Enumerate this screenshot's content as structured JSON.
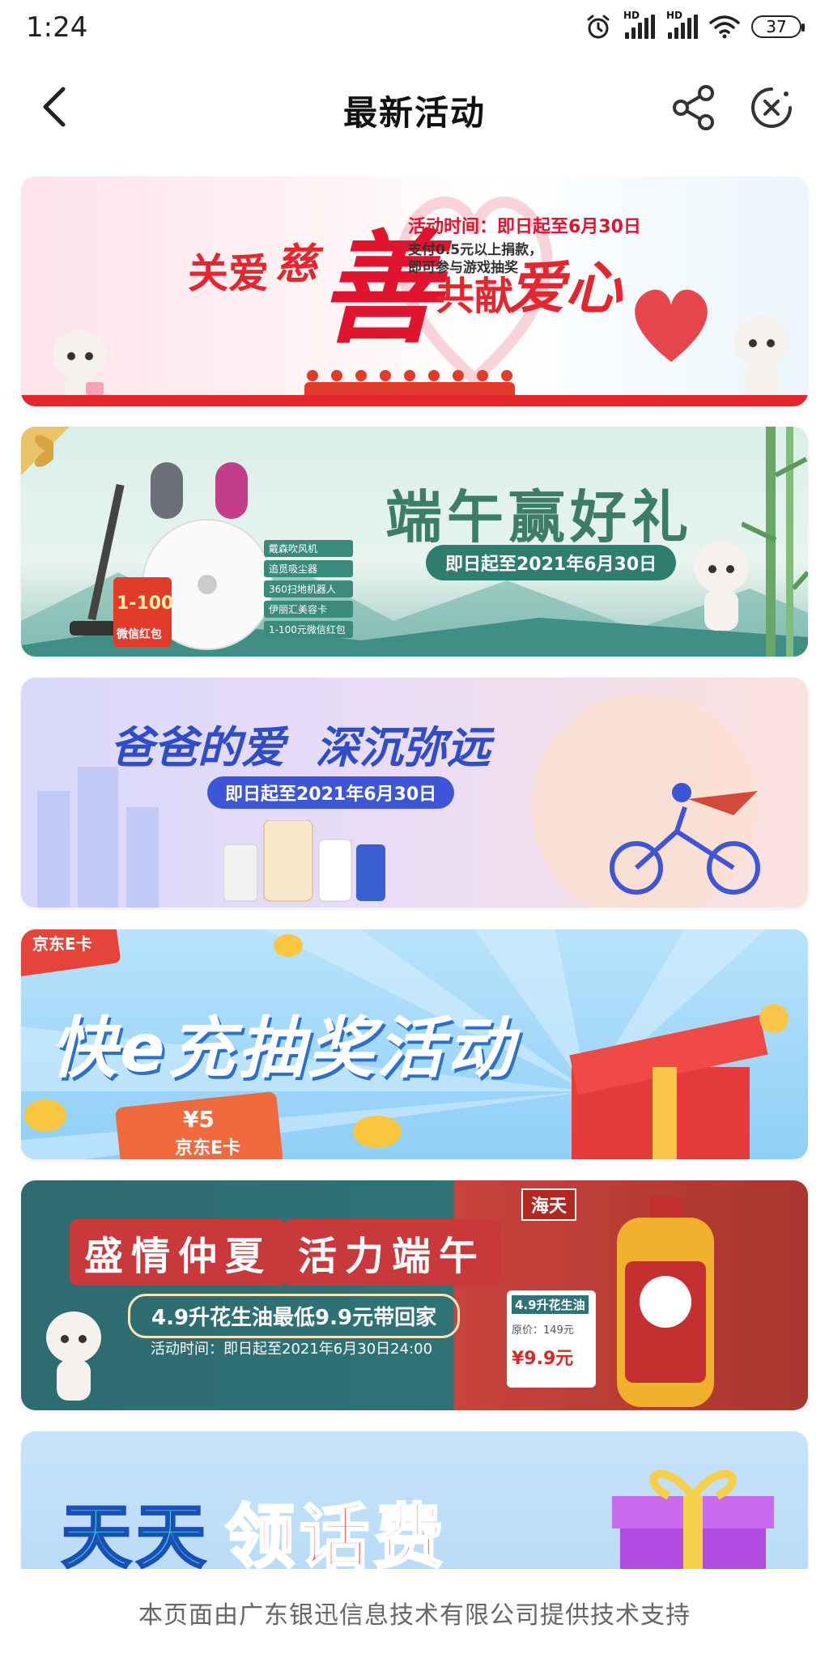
{
  "status": {
    "time": "1:24",
    "battery": "37",
    "hd1": "HD",
    "hd2": "HD"
  },
  "nav": {
    "title": "最新活动"
  },
  "banners": [
    {
      "title_left": "关爱",
      "title_mid1": "慈",
      "title_big": "善",
      "title_mid2": "共献",
      "title_right": "爱心",
      "line1": "活动时间：即日起至6月30日",
      "line2": "支付0.5元以上捐款，",
      "line3": "即可参与游戏抽奖"
    },
    {
      "title": "端午赢好礼",
      "date": "即日起至2021年6月30日",
      "prizes": [
        "戴森吹风机",
        "追觅吸尘器",
        "360扫地机器人",
        "伊丽汇美容卡",
        "1-100元微信红包"
      ],
      "redpacket_value": "1-100",
      "redpacket_label": "微信红包"
    },
    {
      "title": "爸爸的爱  深沉弥远",
      "date": "即日起至2021年6月30日"
    },
    {
      "card_tag": "京东E卡",
      "title": "快e充抽奖活动",
      "card_value": "¥5",
      "card_label": "京东E卡"
    },
    {
      "title1": "盛情仲夏",
      "title2": "活力端午",
      "brand": "海天",
      "sub": "4.9升花生油最低9.9元带回家",
      "time": "活动时间：即日起至2021年6月30日24:00",
      "tag_name": "4.9升花生油",
      "tag_orig": "原价：149元",
      "tag_price": "¥9.9元"
    },
    {
      "title_a": "天天",
      "title_b": "领话费"
    }
  ],
  "footer": {
    "text": "本页面由广东银迅信息技术有限公司提供技术支持"
  }
}
